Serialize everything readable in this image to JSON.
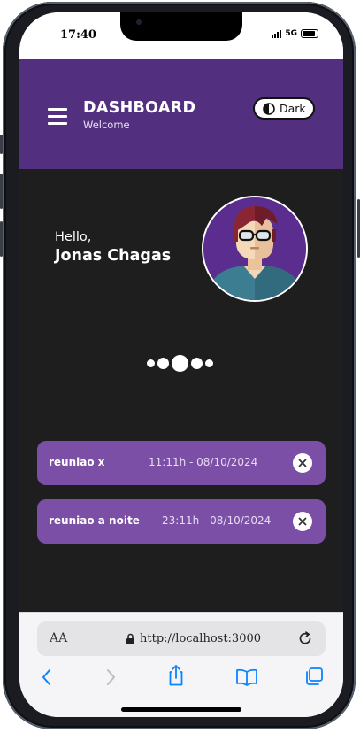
{
  "status_bar": {
    "time": "17:40",
    "network": "5G"
  },
  "header": {
    "title": "DASHBOARD",
    "subtitle": "Welcome",
    "theme_toggle_label": "Dark"
  },
  "greeting": {
    "hello": "Hello,",
    "name": "Jonas Chagas"
  },
  "carousel": {
    "dot_count": 5,
    "active_index": 2
  },
  "events": [
    {
      "name": "reuniao x",
      "time": "11:11h - 08/10/2024"
    },
    {
      "name": "reuniao a noite",
      "time": "23:11h - 08/10/2024"
    }
  ],
  "browser": {
    "text_size_label": "AA",
    "url": "http://localhost:3000"
  },
  "colors": {
    "header_bg": "#52307f",
    "body_bg": "#1e1e1e",
    "card_bg": "#7a4fa5",
    "ios_blue": "#0a84ff"
  },
  "icons": {
    "menu": "hamburger-menu-icon",
    "theme": "contrast-icon",
    "close": "close-x-icon",
    "lock": "lock-icon",
    "reload": "reload-icon",
    "back": "chevron-left-icon",
    "forward": "chevron-right-icon",
    "share": "share-icon",
    "bookmarks": "book-icon",
    "tabs": "tabs-icon"
  }
}
